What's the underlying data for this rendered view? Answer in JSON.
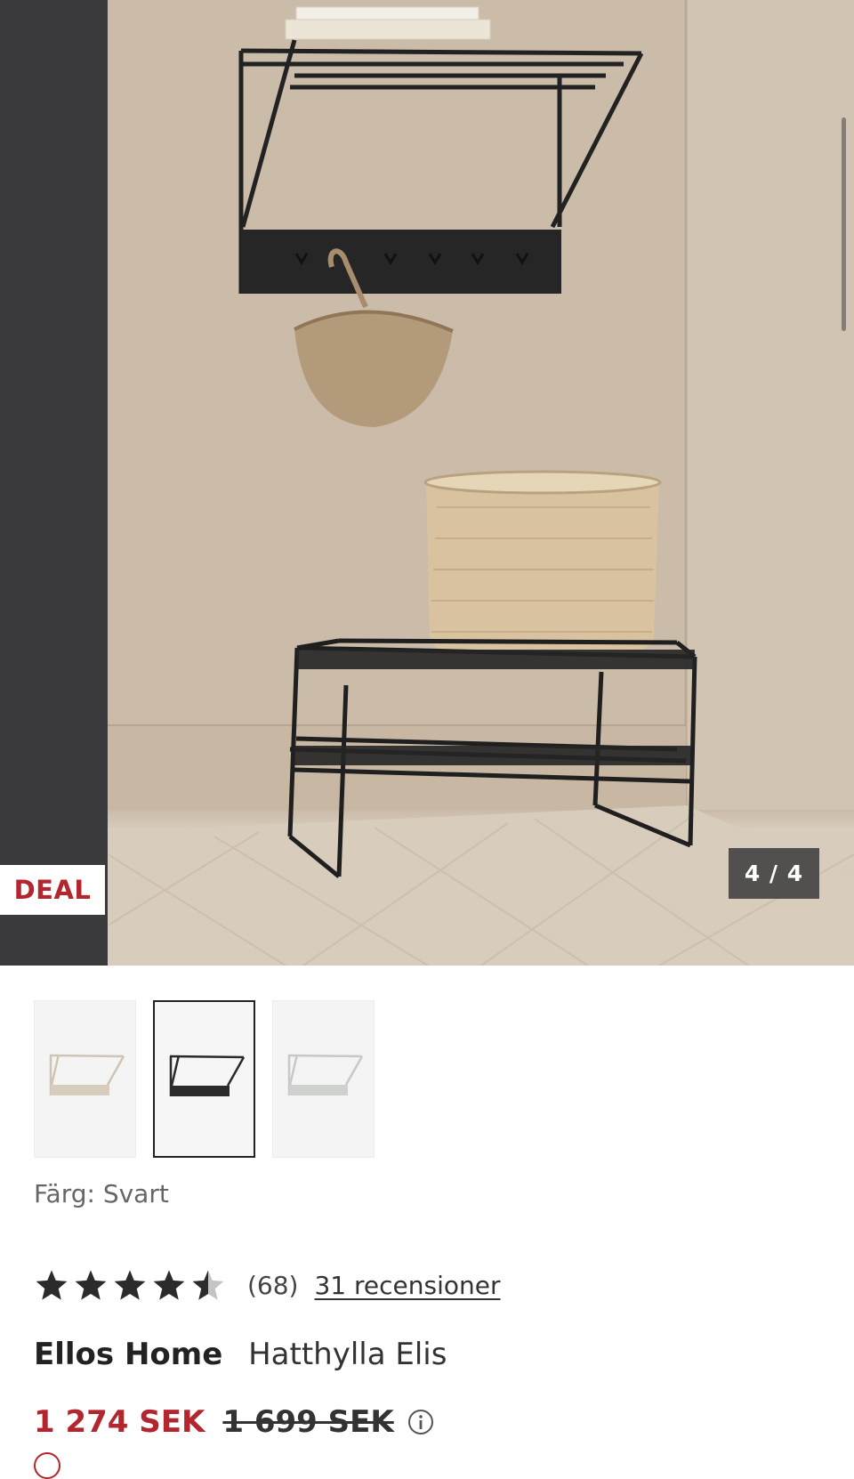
{
  "gallery": {
    "deal_badge": "DEAL",
    "counter": "4 / 4",
    "image_alt": "Hatthylla Elis"
  },
  "variants": {
    "items": [
      {
        "name": "beige-variant",
        "selected": false,
        "color": "#cfc5b5"
      },
      {
        "name": "black-variant",
        "selected": true,
        "color": "#2a2a2a"
      },
      {
        "name": "grey-variant",
        "selected": false,
        "color": "#c7c9c6"
      }
    ]
  },
  "color": {
    "label": "Färg: Svart"
  },
  "rating": {
    "stars": 4.5,
    "count": "(68)",
    "reviews_link": "31 recensioner"
  },
  "product": {
    "brand": "Ellos Home",
    "name": "Hatthylla Elis"
  },
  "price": {
    "current": "1 274 SEK",
    "original": "1 699 SEK"
  },
  "colors": {
    "accent_red": "#b3262e",
    "text_dark": "#222222"
  }
}
